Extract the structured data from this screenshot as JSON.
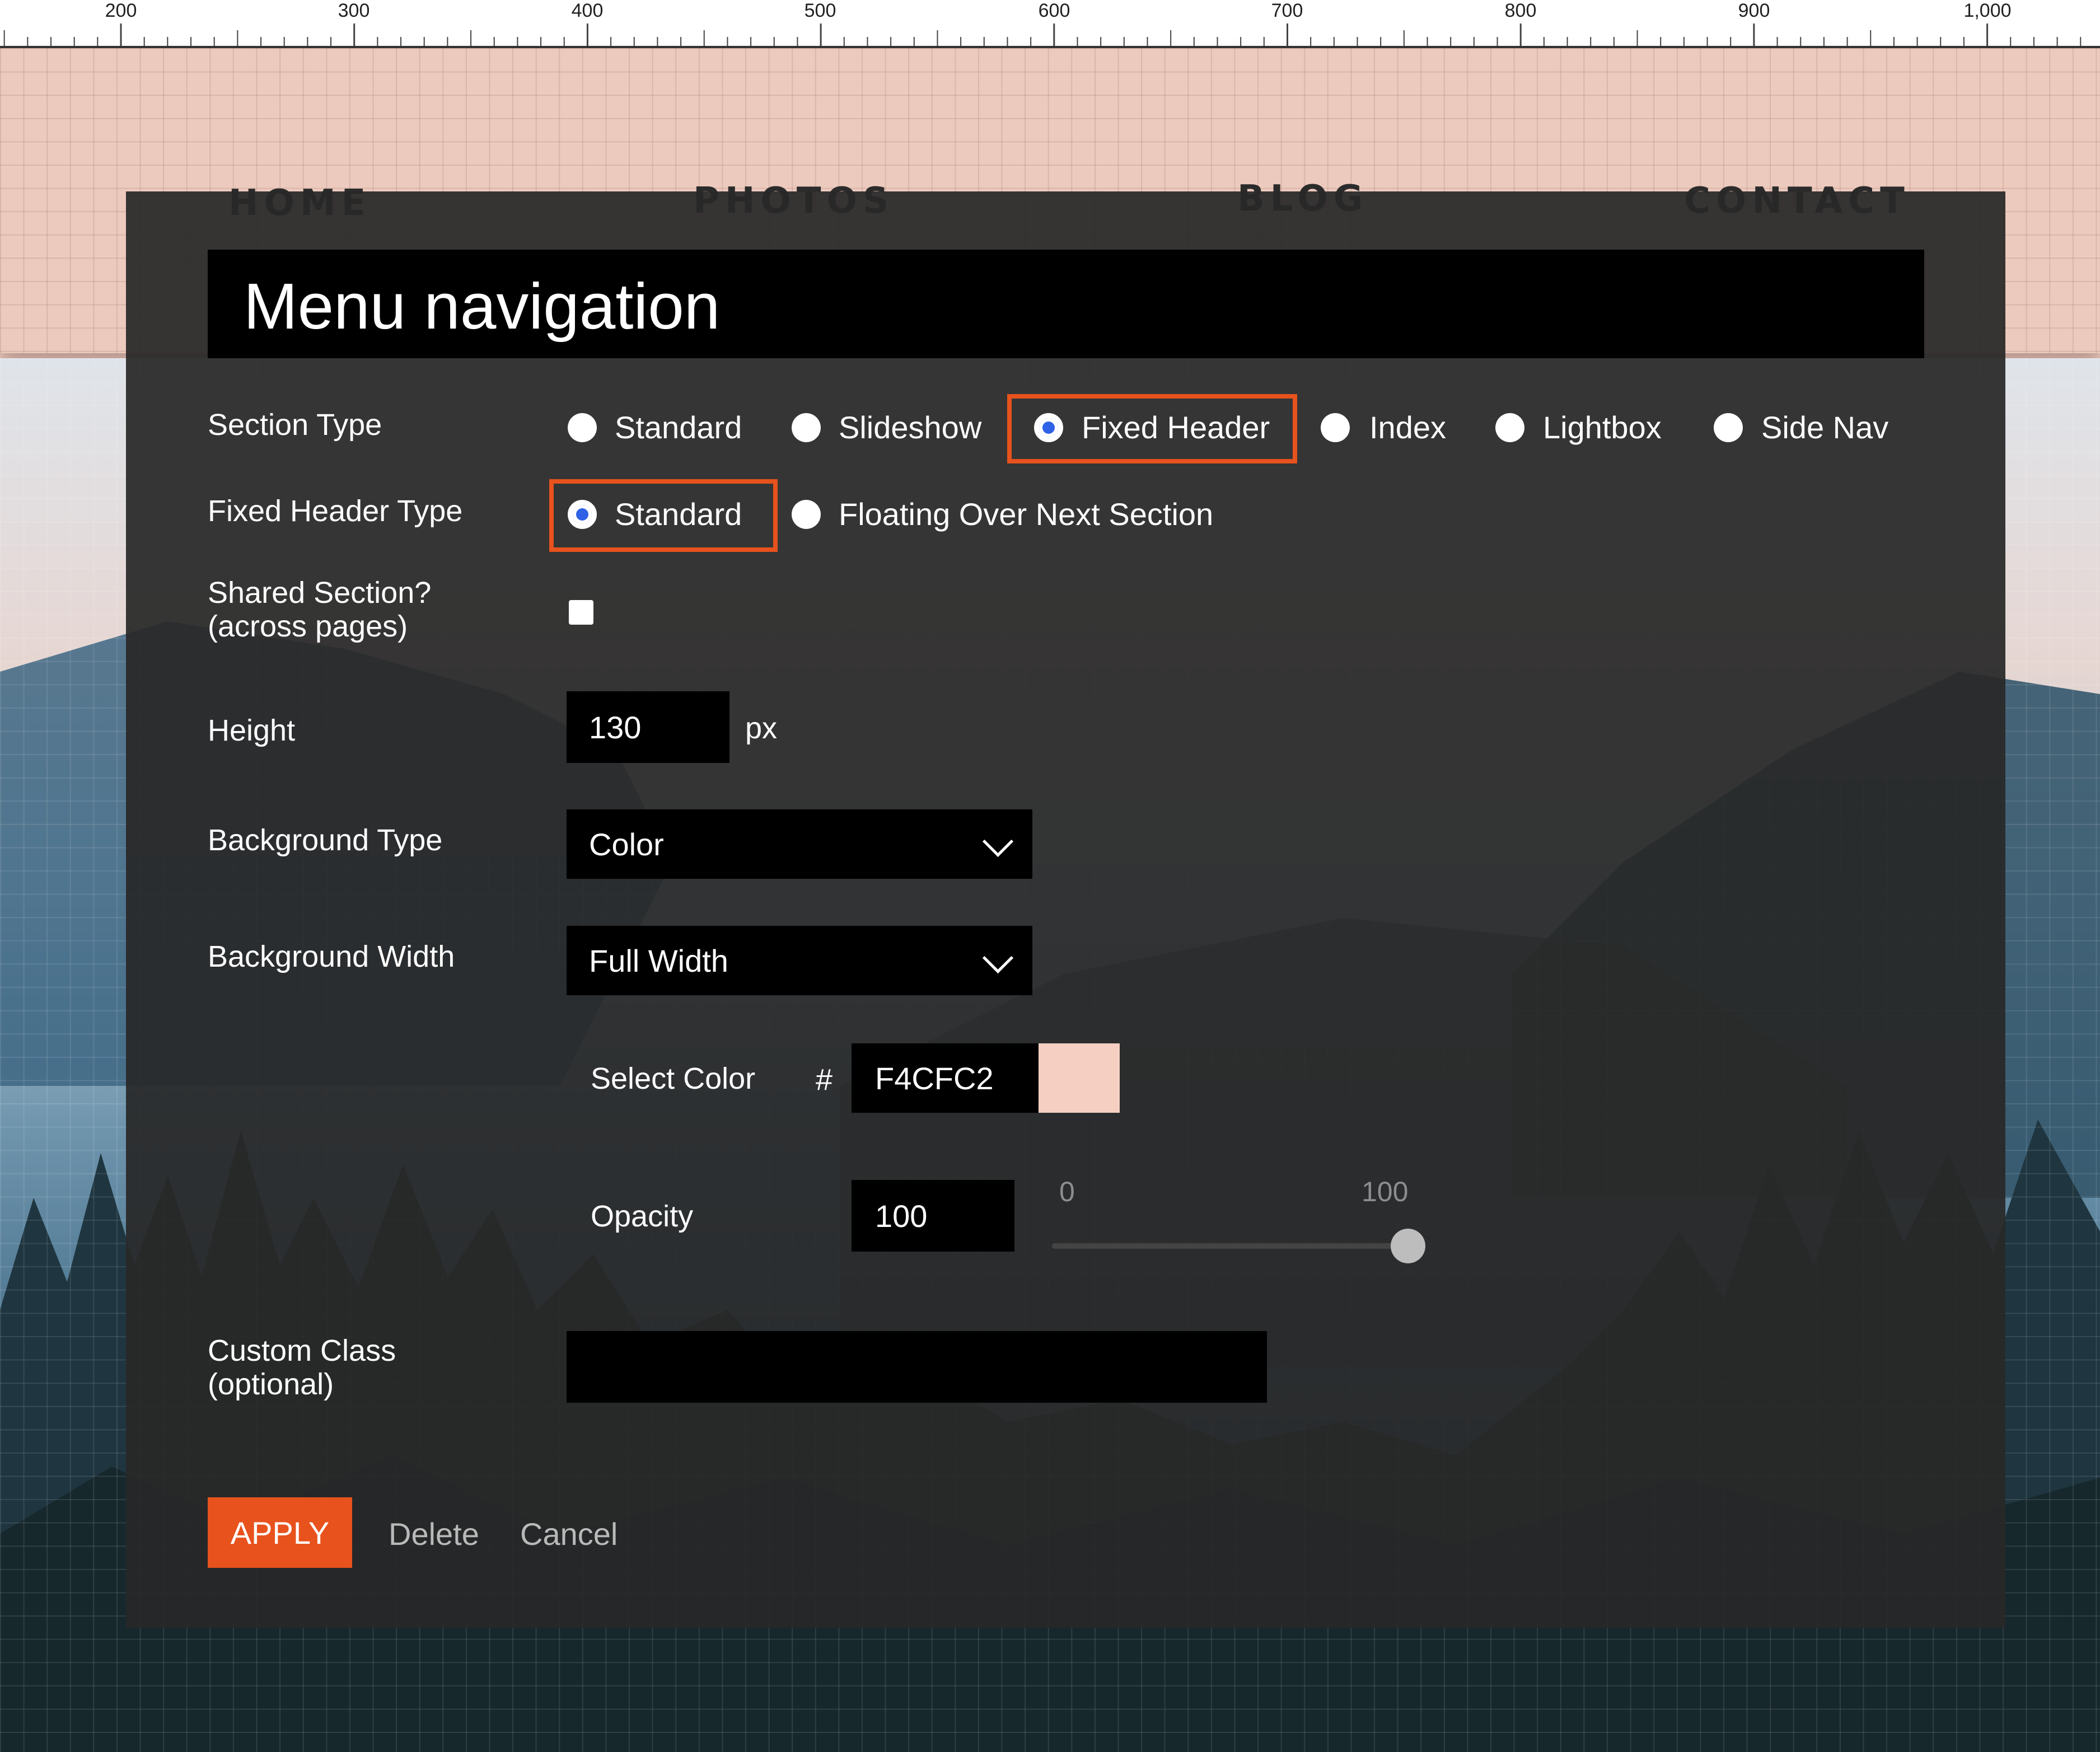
{
  "ruler": {
    "marks": [
      "200",
      "300",
      "400",
      "500",
      "600",
      "700",
      "800",
      "900",
      "1,000"
    ]
  },
  "site_nav": {
    "items": [
      "HOME",
      "PHOTOS",
      "BLOG",
      "CONTACT"
    ]
  },
  "modal": {
    "title": "Menu navigation",
    "section_type": {
      "label": "Section Type",
      "options": [
        "Standard",
        "Slideshow",
        "Fixed Header",
        "Index",
        "Lightbox",
        "Side Nav"
      ],
      "selected": "Fixed Header"
    },
    "fixed_header_type": {
      "label": "Fixed Header Type",
      "options": [
        "Standard",
        "Floating Over Next Section"
      ],
      "selected": "Standard"
    },
    "shared_section": {
      "label_line1": "Shared Section?",
      "label_line2": "(across pages)",
      "checked": false
    },
    "height": {
      "label": "Height",
      "value": "130",
      "unit": "px"
    },
    "background_type": {
      "label": "Background Type",
      "value": "Color"
    },
    "background_width": {
      "label": "Background Width",
      "value": "Full Width"
    },
    "select_color": {
      "label": "Select Color",
      "hash": "#",
      "value": "F4CFC2",
      "swatch_color": "#F4CFC2"
    },
    "opacity": {
      "label": "Opacity",
      "value": "100",
      "min_label": "0",
      "max_label": "100",
      "level": 100
    },
    "custom_class": {
      "label_line1": "Custom Class",
      "label_line2": "(optional)",
      "value": ""
    },
    "buttons": {
      "apply": "APPLY",
      "delete": "Delete",
      "cancel": "Cancel"
    }
  },
  "colors": {
    "accent": "#E8521D",
    "modal_bg": "#2A2A2A",
    "radio_selected": "#2F62E6"
  }
}
